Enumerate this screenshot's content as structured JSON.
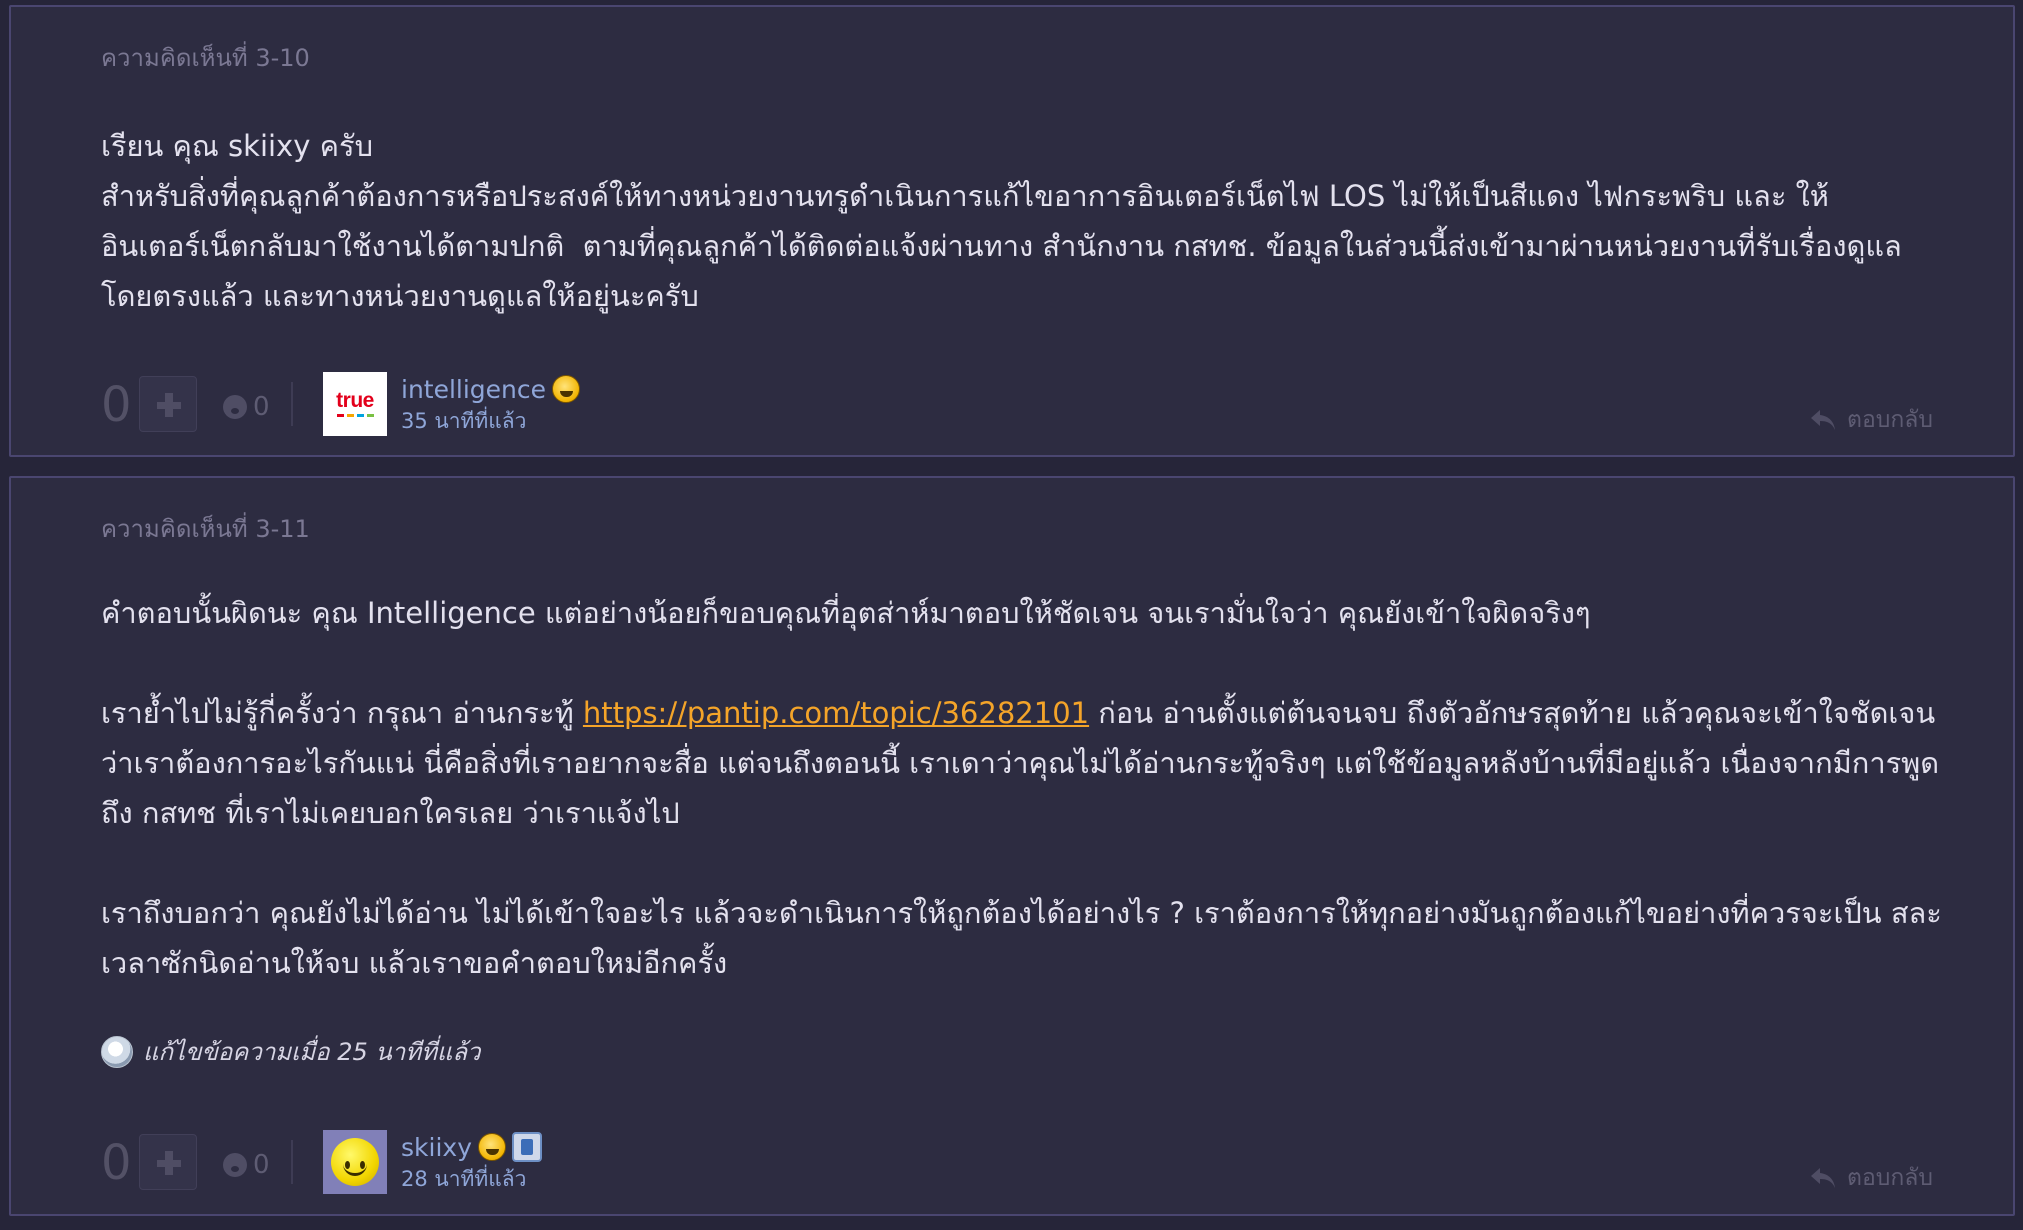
{
  "comments": [
    {
      "number": "ความคิดเห็นที่ 3-10",
      "paragraphs": [
        "เรียน คุณ skiixy ครับ",
        "สำหรับสิ่งที่คุณลูกค้าต้องการหรือประสงค์ให้ทางหน่วยงานทรูดำเนินการแก้ไขอาการอินเตอร์เน็ตไฟ LOS ไม่ให้เป็นสีแดง ไฟกระพริบ และ ให้อินเตอร์เน็ตกลับมาใช้งานได้ตามปกติ  ตามที่คุณลูกค้าได้ติดต่อแจ้งผ่านทาง สำนักงาน กสทช. ข้อมูลในส่วนนี้ส่งเข้ามาผ่านหน่วยงานที่รับเรื่องดูแลโดยตรงแล้ว และทางหน่วยงานดูแลให้อยู่นะครับ"
      ],
      "vote_count": "0",
      "emotion_count": "0",
      "avatar_text": "true",
      "username": "intelligence",
      "time": "35 นาทีที่แล้ว",
      "reply_label": "ตอบกลับ"
    },
    {
      "number": "ความคิดเห็นที่ 3-11",
      "p1": "คำตอบนั้นผิดนะ คุณ Intelligence แต่อย่างน้อยก็ขอบคุณที่อุตส่าห์มาตอบให้ชัดเจน จนเรามั่นใจว่า คุณยังเข้าใจผิดจริงๆ",
      "p2_before": "เราย้ำไปไม่รู้กี่ครั้งว่า กรุณา อ่านกระทู้ ",
      "p2_link": "https://pantip.com/topic/36282101",
      "p2_after": " ก่อน อ่านตั้งแต่ต้นจนจบ ถึงตัวอักษรสุดท้าย แล้วคุณจะเข้าใจชัดเจน ว่าเราต้องการอะไรกันแน่ นี่คือสิ่งที่เราอยากจะสื่อ แต่จนถึงตอนนี้ เราเดาว่าคุณไม่ได้อ่านกระทู้จริงๆ แต่ใช้ข้อมูลหลังบ้านที่มีอยู่แล้ว เนื่องจากมีการพูดถึง กสทช ที่เราไม่เคยบอกใครเลย ว่าเราแจ้งไป",
      "p3": "เราถึงบอกว่า คุณยังไม่ได้อ่าน ไม่ได้เข้าใจอะไร แล้วจะดำเนินการให้ถูกต้องได้อย่างไร ? เราต้องการให้ทุกอย่างมันถูกต้องแก้ไขอย่างที่ควรจะเป็น สละเวลาซักนิดอ่านให้จบ แล้วเราขอคำตอบใหม่อีกครั้ง",
      "edited": "แก้ไขข้อความเมื่อ 25 นาทีที่แล้ว",
      "vote_count": "0",
      "emotion_count": "0",
      "username": "skiixy",
      "time": "28 นาทีที่แล้ว",
      "reply_label": "ตอบกลับ"
    }
  ],
  "colors": {
    "background": "#2d2c41",
    "border": "#4a4670",
    "text": "#e3e1ee",
    "link": "#f4a429",
    "username": "#8fa6d8",
    "muted": "#7b7893"
  }
}
